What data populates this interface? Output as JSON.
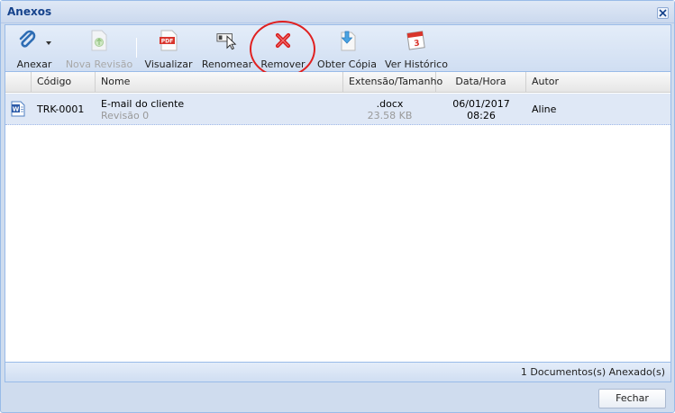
{
  "window": {
    "title": "Anexos"
  },
  "toolbar": {
    "attach_label": "Anexar",
    "new_revision_label": "Nova Revisão",
    "view_label": "Visualizar",
    "rename_label": "Renomear",
    "remove_label": "Remover",
    "get_copy_label": "Obter Cópia",
    "history_label": "Ver Histórico"
  },
  "grid": {
    "headers": {
      "code": "Código",
      "name": "Nome",
      "ext_size": "Extensão/Tamanho",
      "datetime": "Data/Hora",
      "author": "Autor"
    },
    "rows": [
      {
        "icon": "word-doc-icon",
        "code": "TRK-0001",
        "name": "E-mail do cliente",
        "revision": "Revisão 0",
        "extension": ".docx",
        "size": "23.58 KB",
        "date": "06/01/2017",
        "time": "08:26",
        "author": "Aline"
      }
    ]
  },
  "status": {
    "count_text": "1 Documentos(s) Anexado(s)"
  },
  "footer": {
    "close_label": "Fechar"
  },
  "colors": {
    "accent": "#15428b",
    "remove_red": "#d81e1e",
    "highlight_ring": "#e02020"
  }
}
